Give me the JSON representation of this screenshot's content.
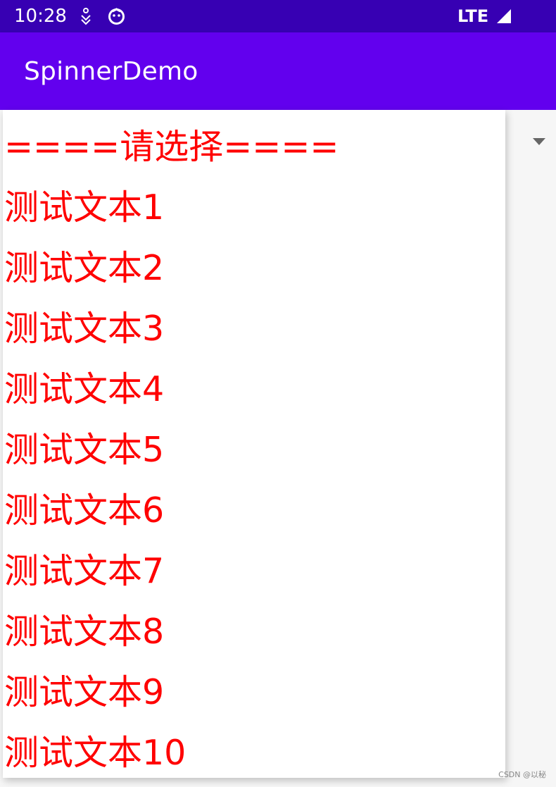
{
  "status_bar": {
    "time": "10:28",
    "network": "LTE",
    "icons": [
      "accessibility-icon",
      "face-icon",
      "signal-icon"
    ]
  },
  "app_bar": {
    "title": "SpinnerDemo"
  },
  "spinner": {
    "options": [
      "====请选择====",
      "测试文本1",
      "测试文本2",
      "测试文本3",
      "测试文本4",
      "测试文本5",
      "测试文本6",
      "测试文本7",
      "测试文本8",
      "测试文本9",
      "测试文本10"
    ],
    "text_color": "#ff0000"
  },
  "watermark": "CSDN @以秘",
  "colors": {
    "status_bar": "#3700b3",
    "app_bar": "#6200ee"
  }
}
